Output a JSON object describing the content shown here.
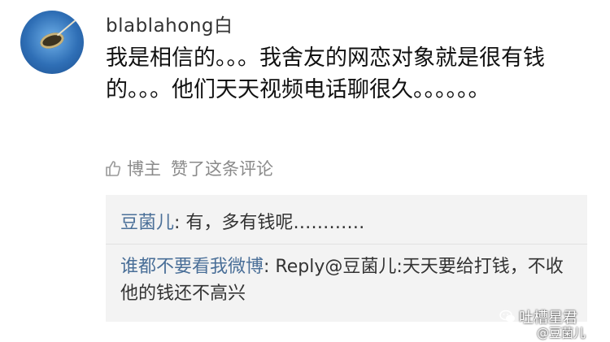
{
  "comment": {
    "username": "blablahong白",
    "text": "我是相信的。。。我舍友的网恋对象就是很有钱的。。。他们天天视频电话聊很久。。。。。。",
    "like_prefix": "博主",
    "like_suffix": "赞了这条评论"
  },
  "replies": [
    {
      "author": "豆菌儿",
      "separator": ": ",
      "text": "有，多有钱呢…………"
    },
    {
      "author": "谁都不要看我微博",
      "separator": ": ",
      "text": "Reply@豆菌儿:天天要给打钱，不收他的钱还不高兴"
    }
  ],
  "watermark": {
    "title": "吐槽星君",
    "handle": "@豆菌儿"
  },
  "icons": {
    "like": "thumbs-up-icon",
    "avatar": "user-avatar",
    "watermark": "wechat-icon"
  },
  "colors": {
    "author_link": "#4a6f98",
    "muted": "#8a8a8a",
    "reply_bg": "#f3f3f3"
  }
}
